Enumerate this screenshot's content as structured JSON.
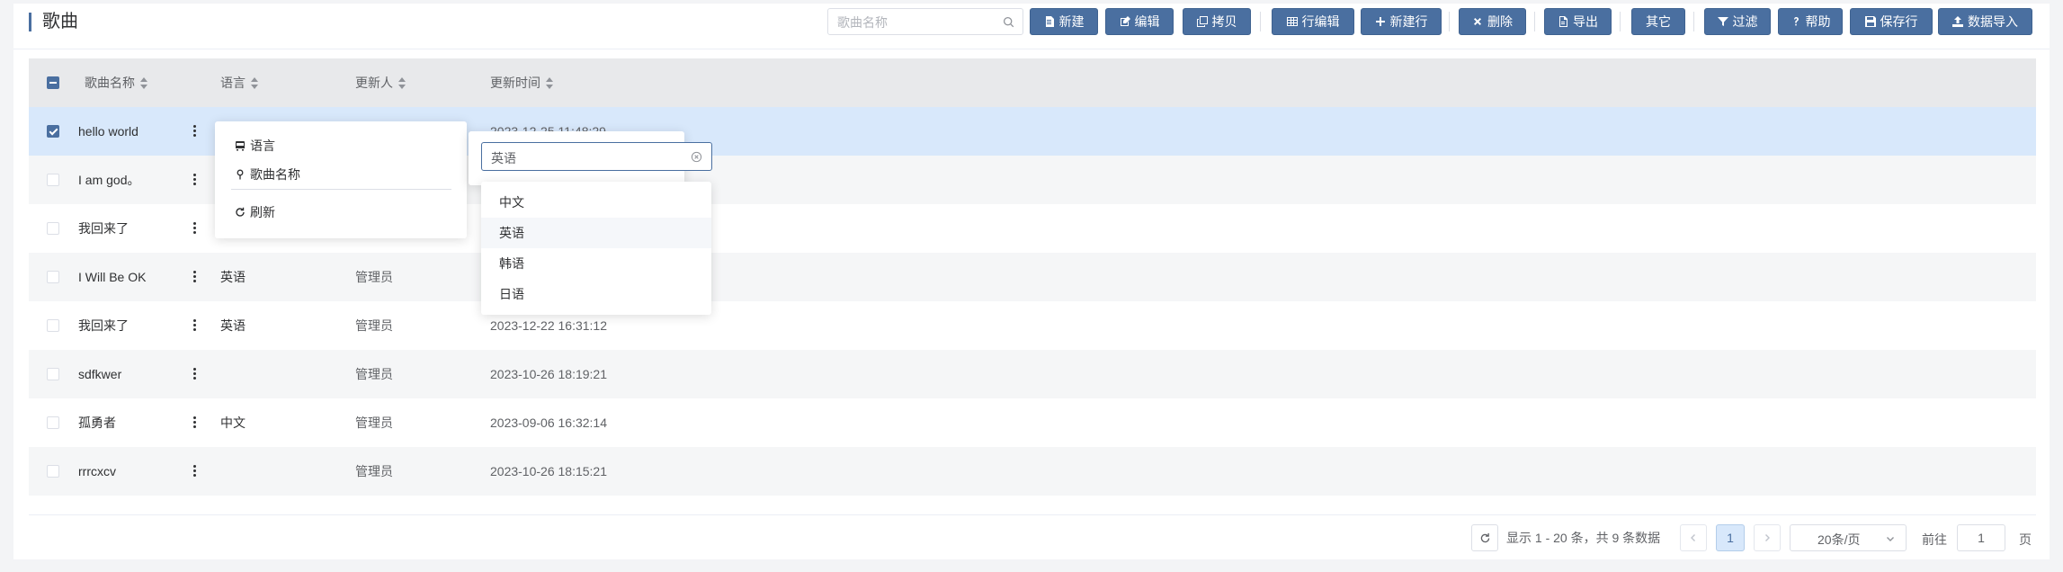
{
  "page": {
    "title": "歌曲"
  },
  "toolbar": {
    "search_placeholder": "歌曲名称",
    "buttons": [
      {
        "id": "new",
        "label": "新建",
        "icon": "file-icon"
      },
      {
        "id": "edit",
        "label": "编辑",
        "icon": "edit-icon"
      },
      {
        "id": "copy",
        "label": "拷贝",
        "icon": "copy-icon"
      },
      {
        "id": "row-edit",
        "label": "行编辑",
        "icon": "table-icon"
      },
      {
        "id": "new-row",
        "label": "新建行",
        "icon": "plus-icon"
      },
      {
        "id": "delete",
        "label": "删除",
        "icon": "close-icon"
      },
      {
        "id": "export",
        "label": "导出",
        "icon": "export-icon"
      },
      {
        "id": "other",
        "label": "其它",
        "icon": ""
      },
      {
        "id": "filter",
        "label": "过滤",
        "icon": "filter-icon"
      },
      {
        "id": "help",
        "label": "帮助",
        "icon": "question-icon"
      },
      {
        "id": "save-row",
        "label": "保存行",
        "icon": "save-icon"
      },
      {
        "id": "import",
        "label": "数据导入",
        "icon": "upload-icon"
      }
    ]
  },
  "table": {
    "columns": [
      "歌曲名称",
      "语言",
      "更新人",
      "更新时间"
    ],
    "rows": [
      {
        "name": "hello world",
        "language": "",
        "updater": "",
        "updated": "2023-12-25 11:48:29",
        "checked": true
      },
      {
        "name": "I am god。",
        "language": "",
        "updater": "",
        "updated": "",
        "checked": false
      },
      {
        "name": "我回来了",
        "language": "",
        "updater": "",
        "updated": "",
        "checked": false
      },
      {
        "name": "I Will Be OK",
        "language": "英语",
        "updater": "管理员",
        "updated": "",
        "checked": false
      },
      {
        "name": "我回来了",
        "language": "英语",
        "updater": "管理员",
        "updated": "2023-12-22 16:31:12",
        "checked": false
      },
      {
        "name": "sdfkwer",
        "language": "",
        "updater": "管理员",
        "updated": "2023-10-26 18:19:21",
        "checked": false
      },
      {
        "name": "孤勇者",
        "language": "中文",
        "updater": "管理员",
        "updated": "2023-09-06 16:32:14",
        "checked": false
      },
      {
        "name": "rrrcxcv",
        "language": "",
        "updater": "管理员",
        "updated": "2023-10-26 18:15:21",
        "checked": false
      }
    ]
  },
  "context_menu": {
    "items": [
      {
        "label": "语言",
        "icon": "bus-icon"
      },
      {
        "label": "歌曲名称",
        "icon": "map-pin-icon"
      },
      {
        "label": "刷新",
        "icon": "refresh-icon"
      }
    ]
  },
  "language_select": {
    "value": "英语",
    "options": [
      "中文",
      "英语",
      "韩语",
      "日语"
    ],
    "hovered": "英语"
  },
  "pagination": {
    "total_text": "显示 1 - 20 条，共 9 条数据",
    "current_page": "1",
    "page_size": "20条/页",
    "goto_label": "前往",
    "goto_value": "1",
    "page_suffix": "页"
  },
  "colors": {
    "primary": "#4a6fa0",
    "selected_row": "#d8e8fb",
    "header_bg": "#e8e9eb"
  }
}
